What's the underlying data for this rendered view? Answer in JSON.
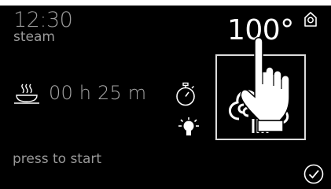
{
  "status": {
    "time": "12:30",
    "mode": "steam"
  },
  "temperature": {
    "value": "100°"
  },
  "timer": {
    "duration": "00 h 25 m"
  },
  "footer": {
    "prompt": "press to start"
  },
  "icons": {
    "home": "home-icon",
    "dish": "dish-steam-icon",
    "stopwatch": "stopwatch-icon",
    "lamp": "lamp-icon",
    "heater": "steam-heater-icon",
    "hand": "pointing-hand-icon",
    "confirm": "check-circle-icon"
  },
  "colors": {
    "background": "#000000",
    "primary_text": "#ffffff",
    "secondary_text": "#9a9a9a"
  }
}
